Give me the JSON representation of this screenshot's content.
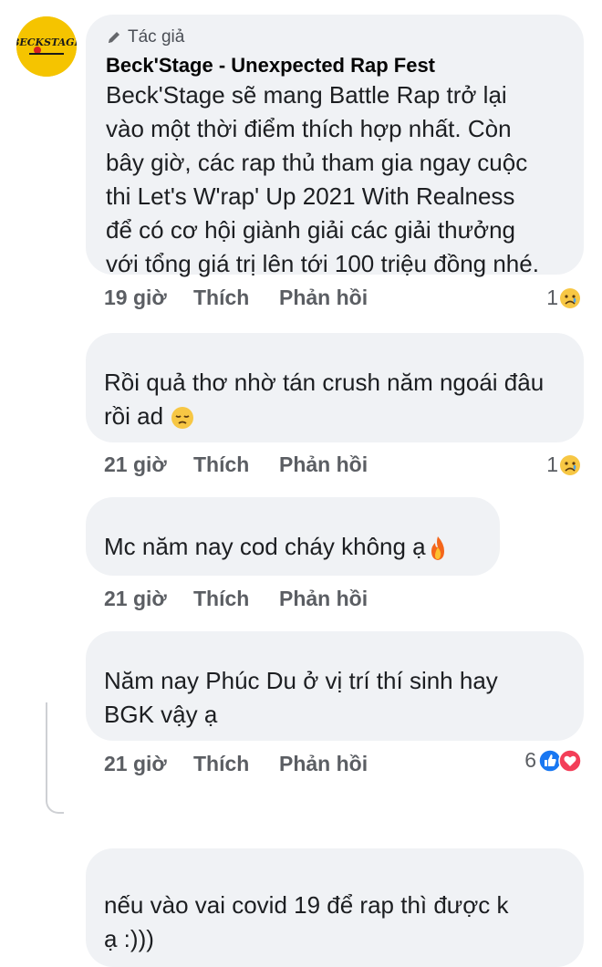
{
  "comments": [
    {
      "author_badge": "Tác giả",
      "author": "Beck'Stage - Unexpected Rap Fest",
      "lines": [
        "Beck'Stage sẽ mang Battle Rap trở lại",
        "vào một thời điểm thích hợp nhất. Còn",
        "bây giờ, các rap thủ tham gia ngay cuộc",
        "thi Let's W'rap' Up 2021 With Realness",
        "để có cơ hội giành giải các giải thưởng",
        "với tổng giá trị lên tới 100 triệu đồng nhé."
      ],
      "time": "19 giờ",
      "like_label": "Thích",
      "reply_label": "Phản hồi",
      "reaction_count": "1"
    },
    {
      "lines": [
        "Rồi quả thơ nhờ tán crush năm ngoái đâu",
        "rồi ad"
      ],
      "time": "21 giờ",
      "like_label": "Thích",
      "reply_label": "Phản hồi",
      "reaction_count": "1"
    },
    {
      "lines": [
        "Mc năm nay cod cháy không ạ"
      ],
      "time": "21 giờ",
      "like_label": "Thích",
      "reply_label": "Phản hồi"
    },
    {
      "lines": [
        "Năm nay Phúc Du ở vị trí thí sinh hay",
        "BGK vậy ạ"
      ],
      "time": "21 giờ",
      "like_label": "Thích",
      "reply_label": "Phản hồi",
      "reaction_count": "6"
    },
    {
      "lines": [
        "nếu vào vai covid 19 để rap thì được k",
        "ạ :)))"
      ]
    }
  ],
  "avatar_logo_text": "BECKSTAGE",
  "colors": {
    "bubble": "#f0f2f5",
    "like_blue": "#1877f2",
    "love_red": "#f33e58",
    "avatar_yellow": "#f5c400"
  },
  "icons": [
    "pencil-icon",
    "sad-reaction-icon",
    "pensive-emoji",
    "fire-emoji",
    "like-reaction-icon",
    "love-reaction-icon"
  ]
}
